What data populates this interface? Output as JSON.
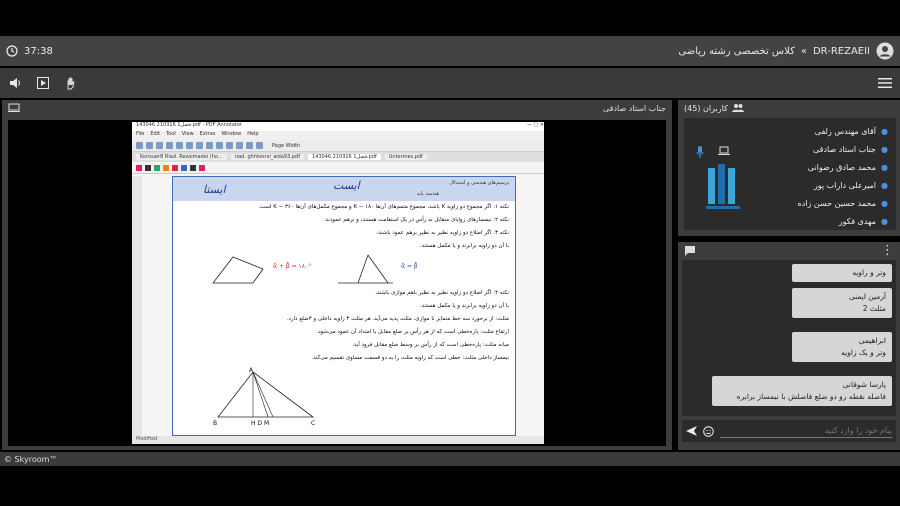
{
  "topbar": {
    "timer": "37:38",
    "breadcrumb_separator": "»",
    "user_code": "DR-REZAEII",
    "class_name": "کلاس تخصصی رشته ریاضی"
  },
  "video": {
    "presenter_title": "جناب استاد صادقی",
    "pdf": {
      "window_title": "143046 210316 فصل1.pdf - PDF Annotator",
      "menu": [
        "File",
        "Edit",
        "Tool",
        "View",
        "Extras",
        "Window",
        "Help"
      ],
      "zoom": "Page Width",
      "tabs": [
        "Konsuer8 Riad. Rezaimadei (ho...",
        "riad. ghhtesrsi_aida93.pdf",
        "143046 210316 فصل1.pdf",
        "Untermes.pdf"
      ],
      "status": "Modified",
      "page_header": "ترسیم‌های هندسی و استدلال",
      "page_sub": "هندسه پایه",
      "lines": [
        "نکته ۱: اگر مجموع دو زاویه K باشد، مجموع متمم‌های آن‌ها K − ۱۸۰ و مجموع مکمل‌های آن‌ها K − ۳۶۰ است.",
        "نکته ۲: نیمسازهای زوایای متقابل به رأس در یک استقامت هستند، و برهم عمودند.",
        "نکته ۳: اگر اضلاع دو زاویه نظیر به نظیر برهم عمود باشند،",
        "با آن دو زاویه برابرند و یا مکمل هستند.",
        "نکته ۴: اگر اضلاع دو زاویه نظیر به نظیر باهم موازی باشند،",
        "با آن دو زاویه برابرند و یا مکمل هستند.",
        "مثلث: از برخورد سه خط متمایز نا موازی، مثلث پدید می‌آید. هر مثلث ۳ زاویه داخلی و ۳ضلع دارد.",
        "ارتفاع مثلث: پاره‌خطی است که از هر رأس بر ضلع مقابل یا امتداد آن عمود می‌شود.",
        "میانه مثلث: پاره‌خطی است که از رأس بر وسط ضلع مقابل فرود آید.",
        "نیمساز داخلی مثلث: خطی است که زاویه مثلث را به دو قسمت مساوی تقسیم می‌کند."
      ],
      "formula1": "α̂ + β̂ = ۱۸۰°",
      "formula2": "α̂ = β̂",
      "scribble1": "ایستا",
      "scribble2": "ایست"
    }
  },
  "users": {
    "title": "کاربران (45)",
    "list": [
      "آقای مهندس زلفی",
      "جناب استاد صادقی",
      "محمد صادق رضوانی",
      "امیرعلی داراب پور",
      "محمد حسین حسن زاده",
      "مهدی فکور"
    ]
  },
  "chat": {
    "messages": [
      {
        "name": "",
        "text": "وتر و زاویه"
      },
      {
        "name": "آرمین ایمنی",
        "text": "مثلث 2"
      },
      {
        "name": "ابراهیمی",
        "text": "وتر و یک زاویه"
      },
      {
        "name": "پارسا شوقانی",
        "text": "فاصله نقطه رو دو ضلع فاصلش با نیمساز برابره"
      }
    ],
    "input_placeholder": "پیام خود را وارد کنید"
  },
  "footer": {
    "brand": "© Skyroom™"
  },
  "colors": {
    "panel": "#3d3d3d",
    "panel_dark": "#2b2b2b",
    "accent": "#4a8fe0"
  }
}
